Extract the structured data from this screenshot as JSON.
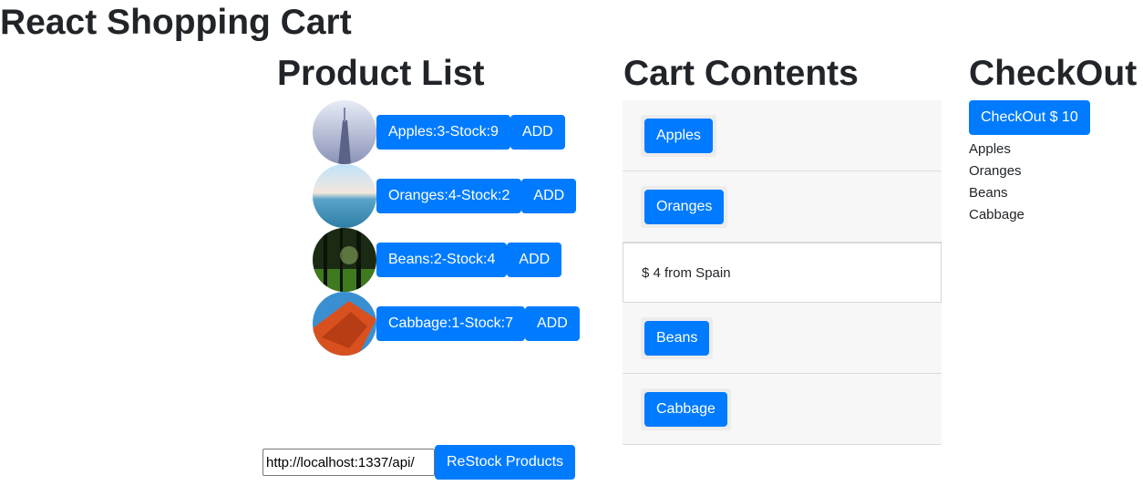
{
  "app": {
    "title": "React Shopping Cart"
  },
  "products": {
    "heading": "Product List",
    "add_label": "ADD",
    "items": [
      {
        "label": "Apples:3-Stock:9",
        "image": "misty-tower-photo"
      },
      {
        "label": "Oranges:4-Stock:2",
        "image": "sea-horizon-photo"
      },
      {
        "label": "Beans:2-Stock:4",
        "image": "forest-photo"
      },
      {
        "label": "Cabbage:1-Stock:7",
        "image": "orange-hammock-photo"
      }
    ],
    "restock": {
      "url_value": "http://localhost:1337/api/",
      "button_label": "ReStock Products"
    }
  },
  "cart": {
    "heading": "Cart Contents",
    "items": [
      "Apples",
      "Oranges",
      "Beans",
      "Cabbage"
    ],
    "expanded_detail": "$ 4 from Spain"
  },
  "checkout": {
    "heading": "CheckOut",
    "button_label": "CheckOut $ 10",
    "items": [
      "Apples",
      "Oranges",
      "Beans",
      "Cabbage"
    ]
  },
  "colors": {
    "primary": "#007bff",
    "text": "#212529",
    "panel": "#f7f7f7"
  }
}
